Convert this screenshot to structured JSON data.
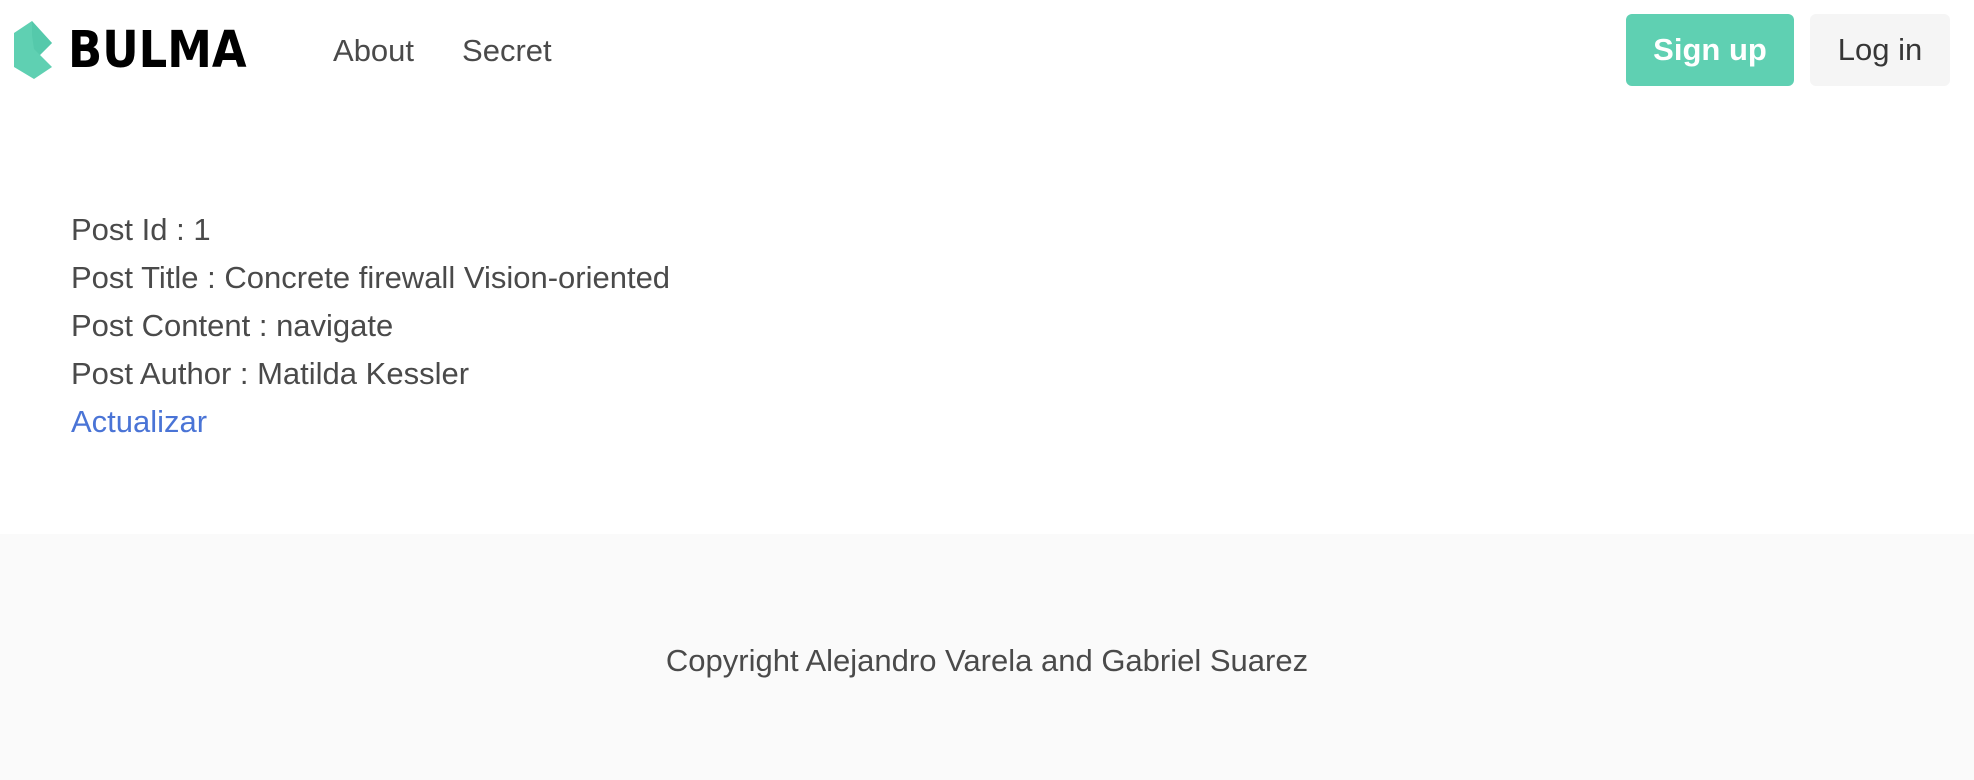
{
  "navbar": {
    "brand": {
      "logo_icon": "bulma-logo-icon",
      "text": "BULMA",
      "logo_color": "#5fd0b2"
    },
    "links": [
      {
        "label": "About"
      },
      {
        "label": "Secret"
      }
    ],
    "buttons": {
      "signup_label": "Sign up",
      "signup_color": "#5fd0b2",
      "login_label": "Log in"
    }
  },
  "post": {
    "id_label": "Post Id : ",
    "id_value": "1",
    "title_label": "Post Title : ",
    "title_value": "Concrete firewall Vision-oriented",
    "content_label": "Post Content : ",
    "content_value": "navigate",
    "author_label": "Post Author : ",
    "author_value": "Matilda Kessler",
    "update_link": "Actualizar",
    "link_color": "#4a74d6"
  },
  "footer": {
    "text": "Copyright Alejandro Varela and Gabriel Suarez"
  }
}
